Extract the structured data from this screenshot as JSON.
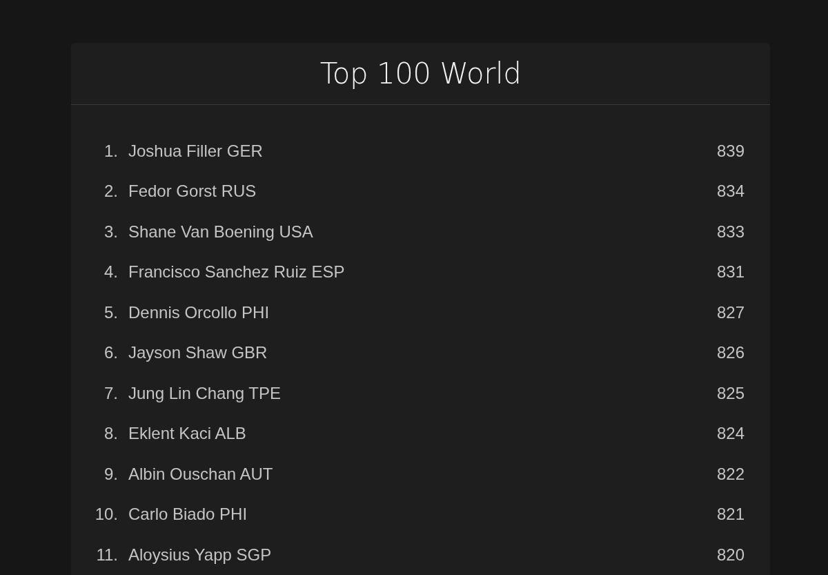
{
  "title": "Top 100 World",
  "rankings": [
    {
      "rank": "1.",
      "name": "Joshua Filler GER",
      "points": "839"
    },
    {
      "rank": "2.",
      "name": "Fedor Gorst RUS",
      "points": "834"
    },
    {
      "rank": "3.",
      "name": "Shane Van Boening USA",
      "points": "833"
    },
    {
      "rank": "4.",
      "name": "Francisco Sanchez Ruiz ESP",
      "points": "831"
    },
    {
      "rank": "5.",
      "name": "Dennis Orcollo PHI",
      "points": "827"
    },
    {
      "rank": "6.",
      "name": "Jayson Shaw GBR",
      "points": "826"
    },
    {
      "rank": "7.",
      "name": "Jung Lin Chang TPE",
      "points": "825"
    },
    {
      "rank": "8.",
      "name": "Eklent Kaci ALB",
      "points": "824"
    },
    {
      "rank": "9.",
      "name": "Albin Ouschan AUT",
      "points": "822"
    },
    {
      "rank": "10.",
      "name": "Carlo Biado PHI",
      "points": "821"
    },
    {
      "rank": "11.",
      "name": "Aloysius Yapp SGP",
      "points": "820"
    }
  ]
}
